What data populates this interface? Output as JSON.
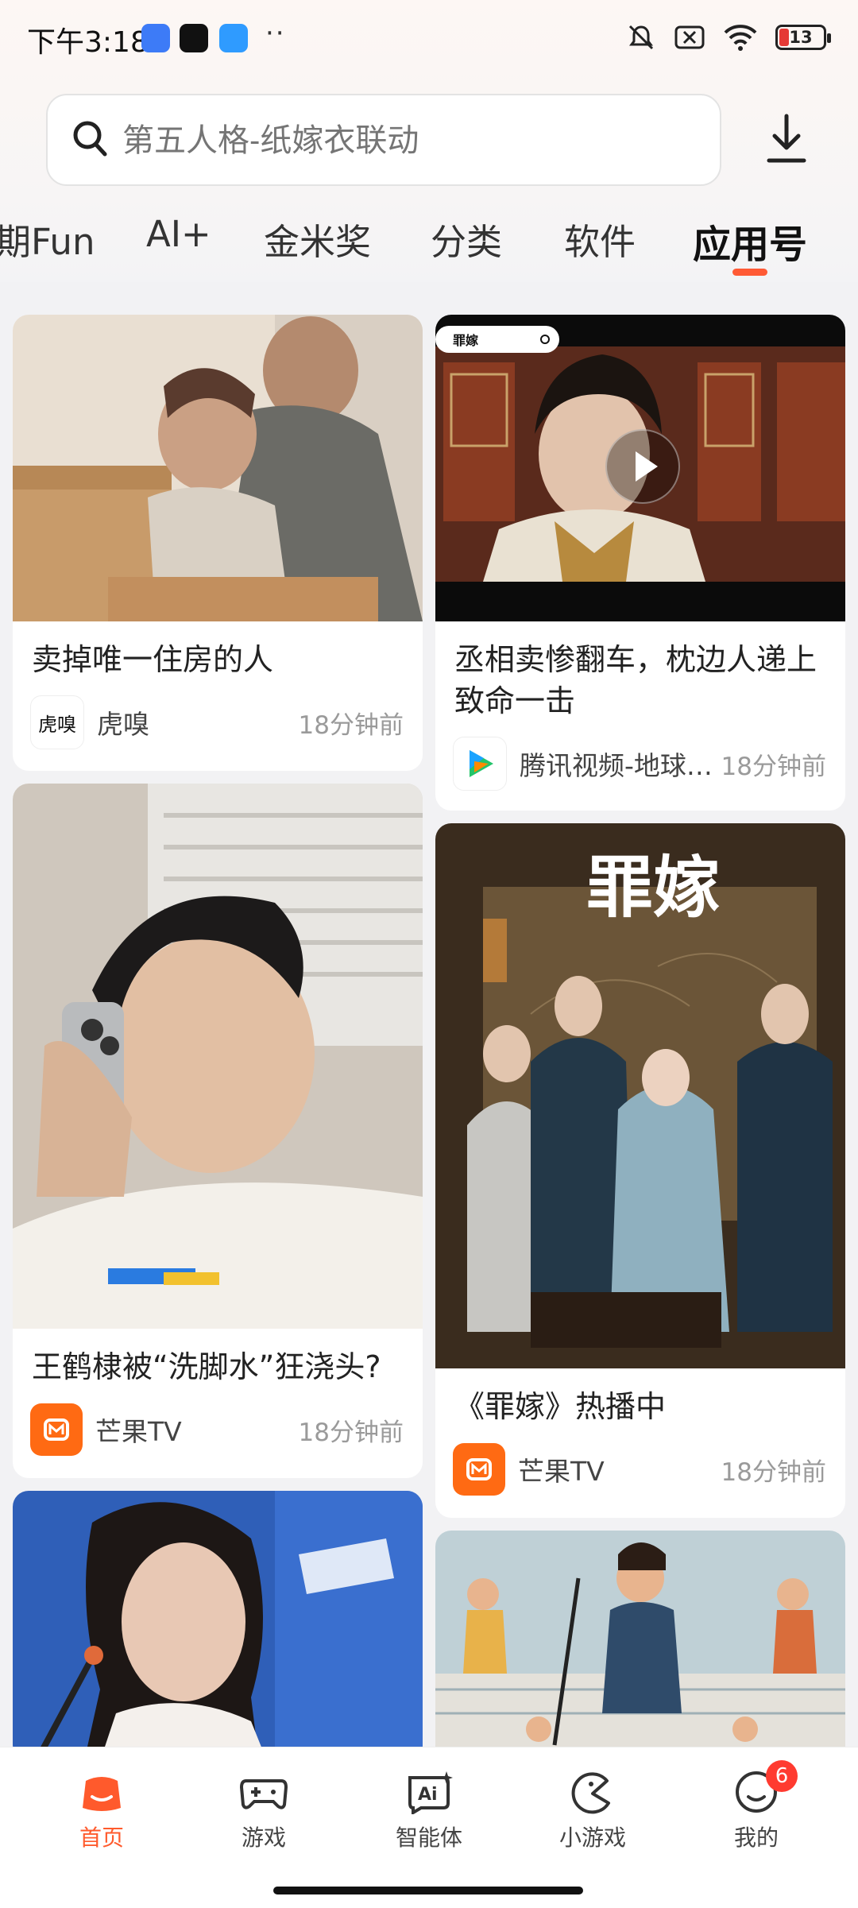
{
  "status_bar": {
    "time": "下午3:18",
    "dots": "··",
    "battery": "13"
  },
  "search": {
    "placeholder": "第五人格-纸嫁衣联动"
  },
  "tabs": [
    "期Fun",
    "AI+",
    "金米奖",
    "分类",
    "软件",
    "应用号"
  ],
  "active_tab": "应用号",
  "feed": {
    "left": [
      {
        "title": "卖掉唯一住房的人",
        "source": "虎嗅",
        "logo_text": "虎嗅",
        "time": "18分钟前"
      },
      {
        "title": "王鹤棣被“洗脚水”狂浇头?",
        "source": "芒果TV",
        "time": "18分钟前"
      }
    ],
    "right": [
      {
        "title": "丞相卖惨翻车，枕边人递上致命一击",
        "source": "腾讯视频-地球…",
        "time": "18分钟前",
        "overlay_label": "罪嫁"
      },
      {
        "title": "《罪嫁》热播中",
        "source": "芒果TV",
        "time": "18分钟前",
        "poster_title": "罪嫁"
      }
    ]
  },
  "bottom_nav": {
    "items": [
      {
        "label": "首页",
        "icon": "home-icon"
      },
      {
        "label": "游戏",
        "icon": "gamepad-icon"
      },
      {
        "label": "智能体",
        "icon": "ai-agent-icon"
      },
      {
        "label": "小游戏",
        "icon": "mini-game-icon"
      },
      {
        "label": "我的",
        "icon": "profile-icon"
      }
    ],
    "profile_badge": "6"
  },
  "colors": {
    "accent": "#ff5a2c",
    "mango": "#ff6a13",
    "badge": "#ff3b30"
  }
}
